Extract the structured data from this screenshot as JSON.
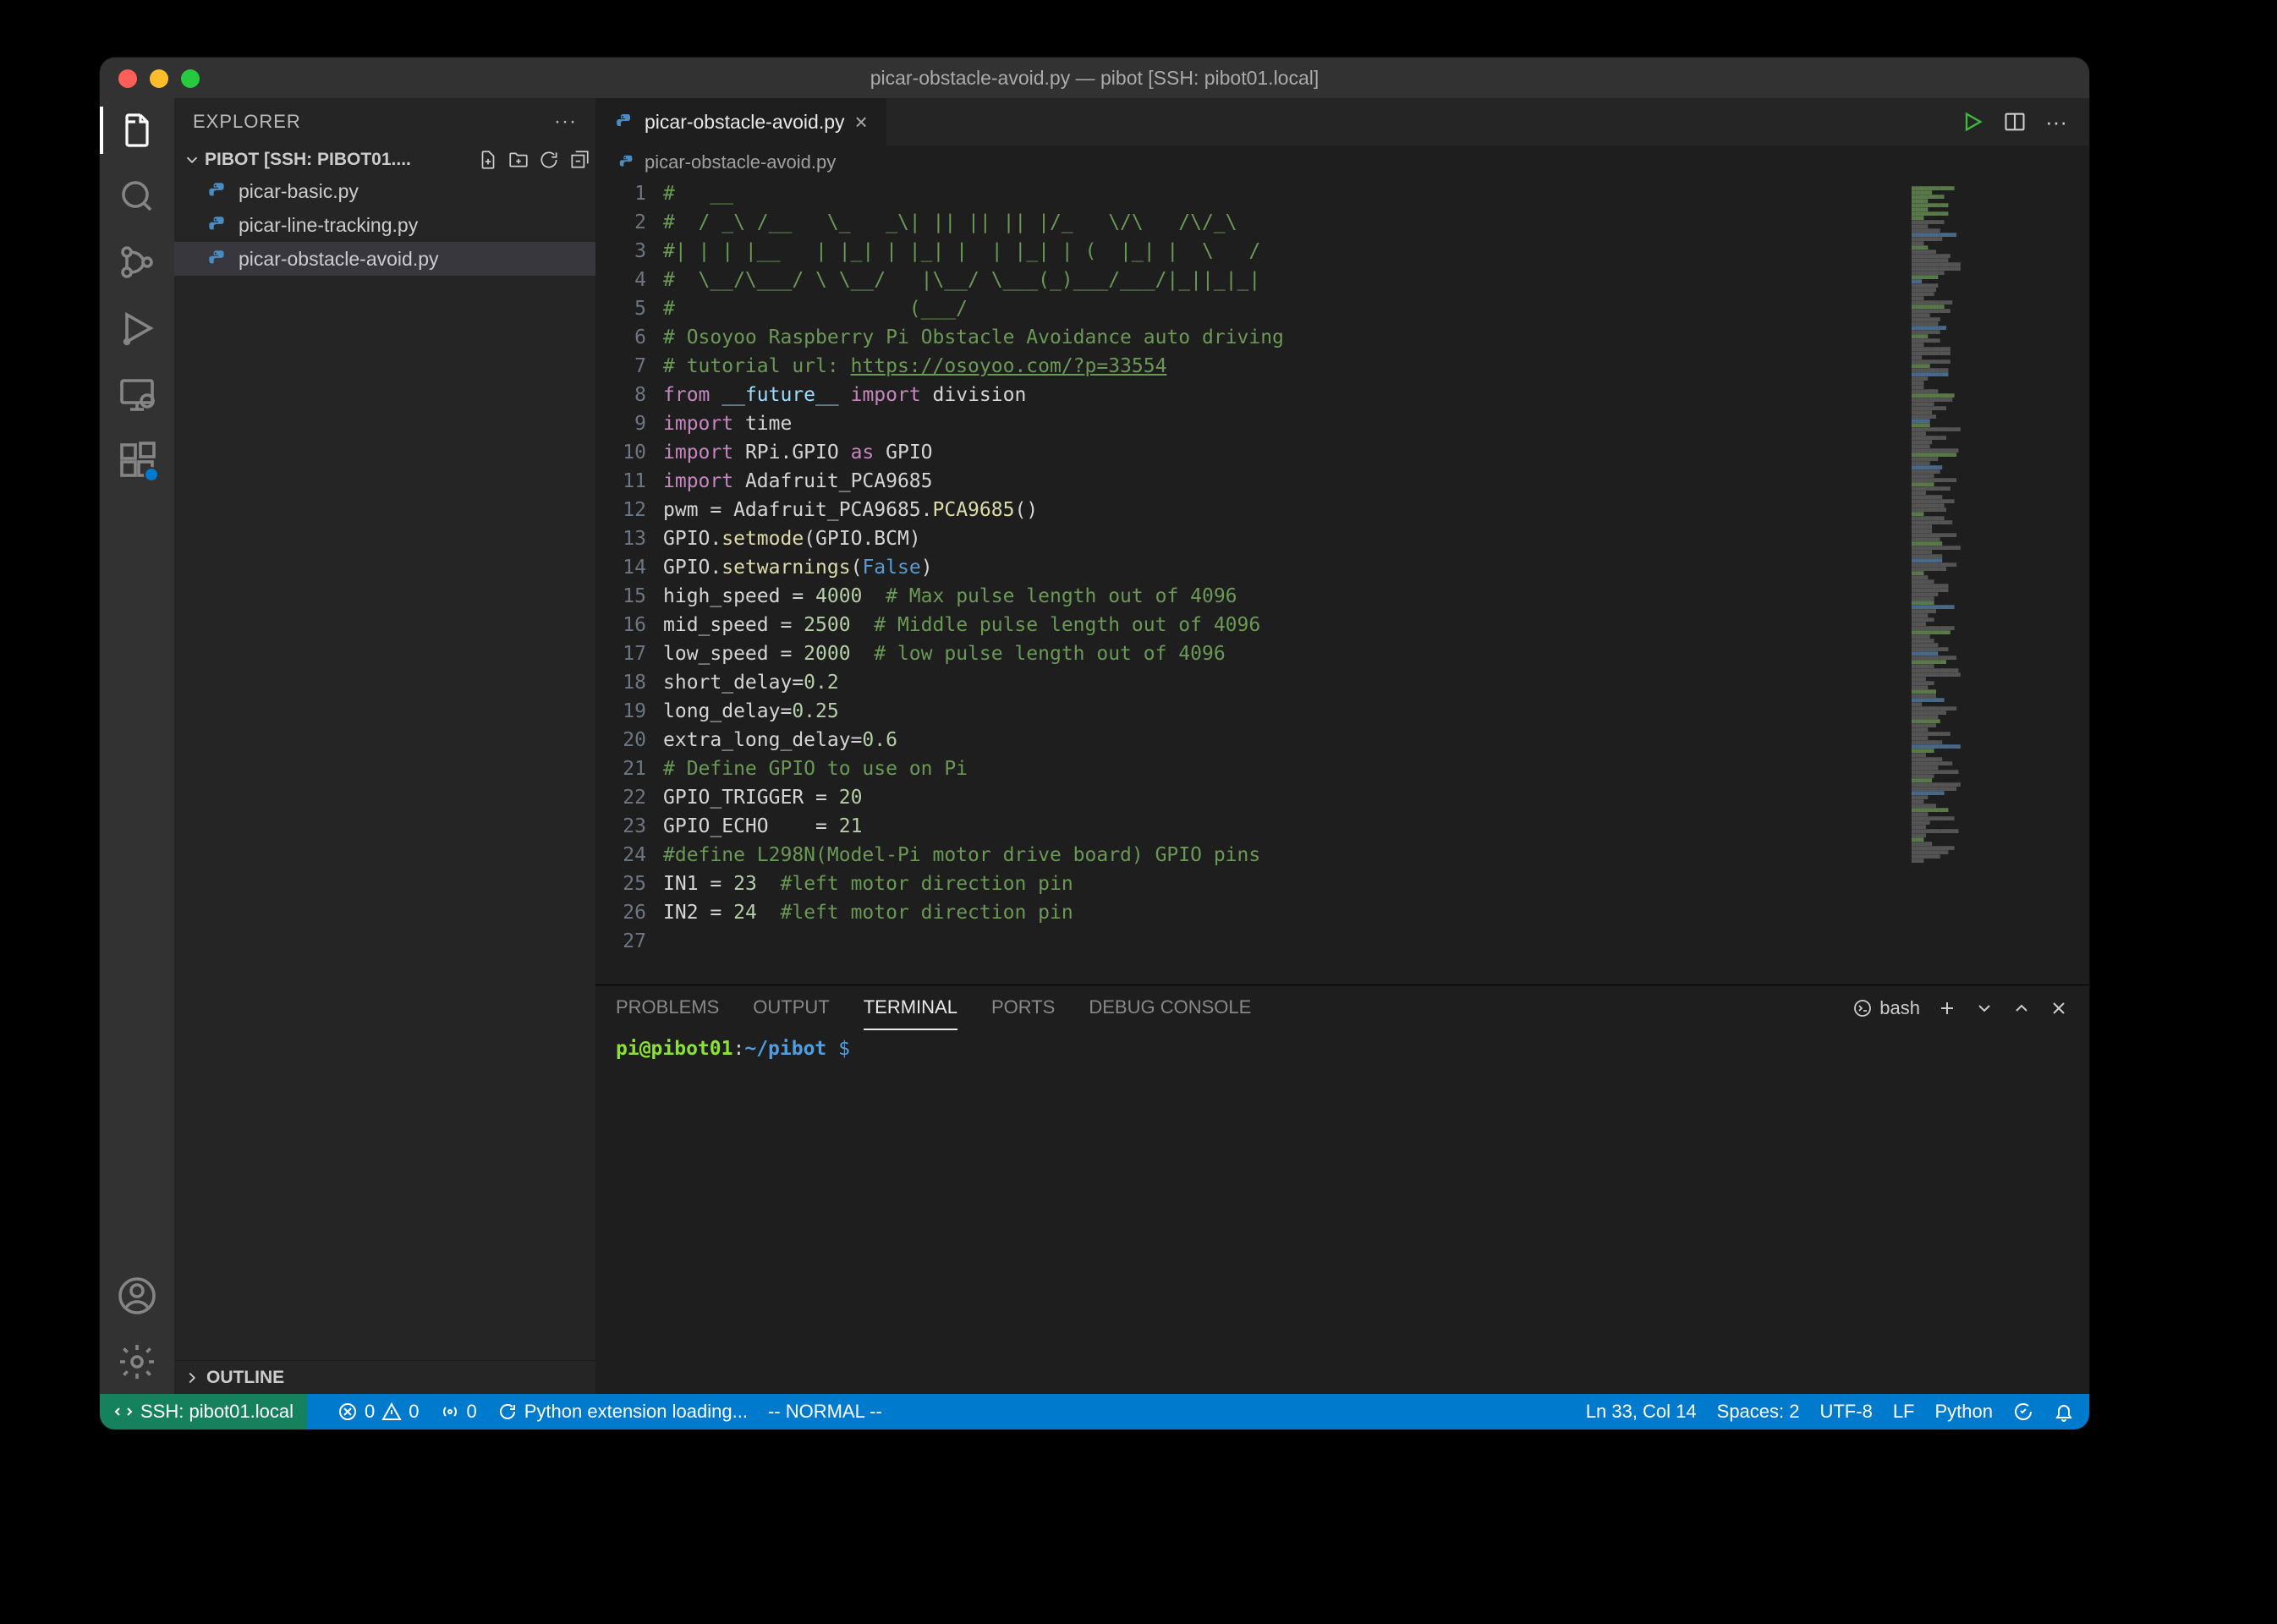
{
  "window": {
    "title": "picar-obstacle-avoid.py — pibot [SSH: pibot01.local]"
  },
  "sidebar": {
    "header": "EXPLORER",
    "section": "PIBOT [SSH: PIBOT01....",
    "files": [
      {
        "name": "picar-basic.py"
      },
      {
        "name": "picar-line-tracking.py"
      },
      {
        "name": "picar-obstacle-avoid.py"
      }
    ],
    "outline": "OUTLINE"
  },
  "tab": {
    "label": "picar-obstacle-avoid.py"
  },
  "tab_actions": {
    "run": "▷"
  },
  "breadcrumb": {
    "file": "picar-obstacle-avoid.py"
  },
  "code": {
    "lines": [
      {
        "n": 1,
        "segs": [
          {
            "cls": "c",
            "t": "#   __                                    "
          }
        ]
      },
      {
        "n": 2,
        "segs": [
          {
            "cls": "c",
            "t": "#  / _\\ /__   \\_   _\\| || || || |/_   \\/\\   /\\/_\\   "
          }
        ]
      },
      {
        "n": 3,
        "segs": [
          {
            "cls": "c",
            "t": "#| | | |__   | |_| | |_| |  | |_| | (  |_| |  \\   / "
          }
        ]
      },
      {
        "n": 4,
        "segs": [
          {
            "cls": "c",
            "t": "#  \\__/\\___/ \\ \\__/   |\\__/ \\___(_)___/___/|_||_|_| "
          }
        ]
      },
      {
        "n": 5,
        "segs": [
          {
            "cls": "c",
            "t": "#                    (___/                         "
          }
        ]
      },
      {
        "n": 6,
        "segs": [
          {
            "cls": "c",
            "t": "# Osoyoo Raspberry Pi Obstacle Avoidance auto driving"
          }
        ]
      },
      {
        "n": 7,
        "segs": [
          {
            "cls": "c",
            "t": "# tutorial url: "
          },
          {
            "cls": "c url",
            "t": "https://osoyoo.com/?p=33554"
          }
        ]
      },
      {
        "n": 8,
        "segs": [
          {
            "cls": "k",
            "t": "from"
          },
          {
            "cls": "o",
            "t": " "
          },
          {
            "cls": "m",
            "t": "__future__"
          },
          {
            "cls": "o",
            "t": " "
          },
          {
            "cls": "k",
            "t": "import"
          },
          {
            "cls": "o",
            "t": " division"
          }
        ]
      },
      {
        "n": 9,
        "segs": [
          {
            "cls": "k",
            "t": "import"
          },
          {
            "cls": "o",
            "t": " time"
          }
        ]
      },
      {
        "n": 10,
        "segs": [
          {
            "cls": "k",
            "t": "import"
          },
          {
            "cls": "o",
            "t": " RPi.GPIO "
          },
          {
            "cls": "k",
            "t": "as"
          },
          {
            "cls": "o",
            "t": " GPIO"
          }
        ]
      },
      {
        "n": 11,
        "segs": [
          {
            "cls": "k",
            "t": "import"
          },
          {
            "cls": "o",
            "t": " Adafruit_PCA9685"
          }
        ]
      },
      {
        "n": 12,
        "segs": [
          {
            "cls": "o",
            "t": "pwm = Adafruit_PCA9685."
          },
          {
            "cls": "f",
            "t": "PCA9685"
          },
          {
            "cls": "o",
            "t": "()"
          }
        ]
      },
      {
        "n": 13,
        "segs": [
          {
            "cls": "o",
            "t": "GPIO."
          },
          {
            "cls": "f",
            "t": "setmode"
          },
          {
            "cls": "o",
            "t": "(GPIO.BCM)"
          }
        ]
      },
      {
        "n": 14,
        "segs": [
          {
            "cls": "o",
            "t": "GPIO."
          },
          {
            "cls": "f",
            "t": "setwarnings"
          },
          {
            "cls": "o",
            "t": "("
          },
          {
            "cls": "s",
            "t": "False"
          },
          {
            "cls": "o",
            "t": ")"
          }
        ]
      },
      {
        "n": 15,
        "segs": [
          {
            "cls": "o",
            "t": "high_speed = "
          },
          {
            "cls": "n",
            "t": "4000"
          },
          {
            "cls": "o",
            "t": "  "
          },
          {
            "cls": "c",
            "t": "# Max pulse length out of 4096"
          }
        ]
      },
      {
        "n": 16,
        "segs": [
          {
            "cls": "o",
            "t": "mid_speed = "
          },
          {
            "cls": "n",
            "t": "2500"
          },
          {
            "cls": "o",
            "t": "  "
          },
          {
            "cls": "c",
            "t": "# Middle pulse length out of 4096"
          }
        ]
      },
      {
        "n": 17,
        "segs": [
          {
            "cls": "o",
            "t": "low_speed = "
          },
          {
            "cls": "n",
            "t": "2000"
          },
          {
            "cls": "o",
            "t": "  "
          },
          {
            "cls": "c",
            "t": "# low pulse length out of 4096"
          }
        ]
      },
      {
        "n": 18,
        "segs": [
          {
            "cls": "o",
            "t": "short_delay="
          },
          {
            "cls": "n",
            "t": "0.2"
          }
        ]
      },
      {
        "n": 19,
        "segs": [
          {
            "cls": "o",
            "t": "long_delay="
          },
          {
            "cls": "n",
            "t": "0.25"
          }
        ]
      },
      {
        "n": 20,
        "segs": [
          {
            "cls": "o",
            "t": "extra_long_delay="
          },
          {
            "cls": "n",
            "t": "0.6"
          }
        ]
      },
      {
        "n": 21,
        "segs": [
          {
            "cls": "o",
            "t": ""
          }
        ]
      },
      {
        "n": 22,
        "segs": [
          {
            "cls": "c",
            "t": "# Define GPIO to use on Pi"
          }
        ]
      },
      {
        "n": 23,
        "segs": [
          {
            "cls": "o",
            "t": "GPIO_TRIGGER = "
          },
          {
            "cls": "n",
            "t": "20"
          }
        ]
      },
      {
        "n": 24,
        "segs": [
          {
            "cls": "o",
            "t": "GPIO_ECHO    = "
          },
          {
            "cls": "n",
            "t": "21"
          }
        ]
      },
      {
        "n": 25,
        "segs": [
          {
            "cls": "c",
            "t": "#define L298N(Model-Pi motor drive board) GPIO pins"
          }
        ]
      },
      {
        "n": 26,
        "segs": [
          {
            "cls": "o",
            "t": "IN1 = "
          },
          {
            "cls": "n",
            "t": "23"
          },
          {
            "cls": "o",
            "t": "  "
          },
          {
            "cls": "c",
            "t": "#left motor direction pin"
          }
        ]
      },
      {
        "n": 27,
        "segs": [
          {
            "cls": "o",
            "t": "IN2 = "
          },
          {
            "cls": "n",
            "t": "24"
          },
          {
            "cls": "o",
            "t": "  "
          },
          {
            "cls": "c",
            "t": "#left motor direction pin"
          }
        ]
      }
    ]
  },
  "panel": {
    "tabs": {
      "problems": "PROBLEMS",
      "output": "OUTPUT",
      "terminal": "TERMINAL",
      "ports": "PORTS",
      "debug": "DEBUG CONSOLE"
    },
    "shell": "bash",
    "prompt": {
      "user": "pi@pibot01",
      "sep": ":",
      "path": "~/pibot",
      "sigil": " $"
    }
  },
  "status": {
    "remote": "SSH: pibot01.local",
    "errors": "0",
    "warnings": "0",
    "ports": "0",
    "loading": "Python extension loading...",
    "vim": "-- NORMAL --",
    "lncol": "Ln 33, Col 14",
    "spaces": "Spaces: 2",
    "encoding": "UTF-8",
    "eol": "LF",
    "lang": "Python"
  }
}
